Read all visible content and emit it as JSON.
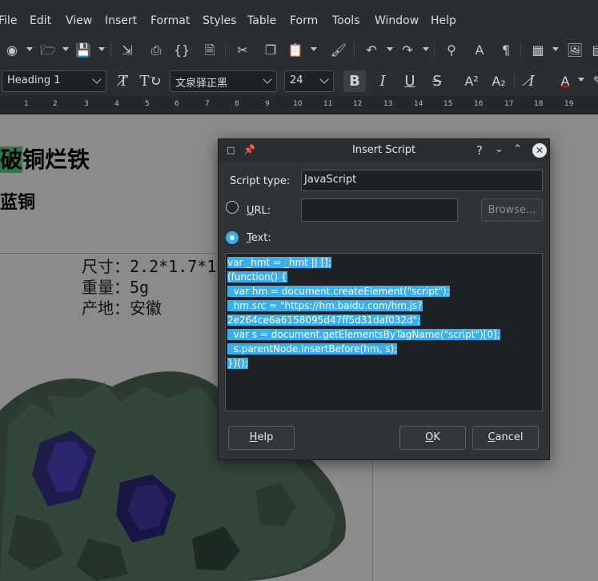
{
  "menubar": {
    "items": [
      "File",
      "Edit",
      "View",
      "Insert",
      "Format",
      "Styles",
      "Table",
      "Form",
      "Tools",
      "Window",
      "Help"
    ]
  },
  "toolbar1": {
    "icons": [
      "globe-icon",
      "folder-open-icon",
      "save-icon",
      "export-pdf-icon",
      "print-icon",
      "braces-icon",
      "print-preview-icon",
      "cut-icon",
      "copy-icon",
      "paste-icon",
      "clone-formatting-icon",
      "undo-icon",
      "redo-icon",
      "find-icon",
      "spelling-icon",
      "pilcrow-icon",
      "table-icon",
      "image-icon"
    ]
  },
  "toolbar2": {
    "paragraph_style": "Heading 1",
    "font_name": "文泉驿正黑",
    "font_size": "24"
  },
  "ruler": {
    "ticks": [
      "1",
      "2",
      "3",
      "4",
      "5",
      "6",
      "7",
      "8",
      "9",
      "10",
      "11",
      "12",
      "13",
      "14",
      "15",
      "16",
      "17",
      "18",
      "19"
    ]
  },
  "document": {
    "heading1_prefix": "破",
    "heading1_rest": "铜烂铁",
    "heading2": "蓝铜",
    "captions": [
      "尺寸：2.2*1.7*1",
      "重量：5g",
      "产地：安徽"
    ]
  },
  "dialog": {
    "title": "Insert Script",
    "help_glyph": "?",
    "script_type_label": "Script type:",
    "script_type_value": "JavaScript",
    "url_label": "URL:",
    "url_value": "",
    "browse_label": "Browse...",
    "text_label": "Text:",
    "url_selected": false,
    "text_selected": true,
    "code_lines": [
      "var _hmt = _hmt || [];",
      "(function() {",
      "  var hm = document.createElement(\"script\");",
      "  hm.src = \"https://hm.baidu.com/hm.js?",
      "2e264ce6a6158095d47ff5d31daf032d\";",
      "  var s = document.getElementsByTagName(\"script\")[0];",
      "  s.parentNode.insertBefore(hm, s);",
      "})();"
    ],
    "help_button": "Help",
    "ok_button": "OK",
    "cancel_button": "Cancel"
  }
}
